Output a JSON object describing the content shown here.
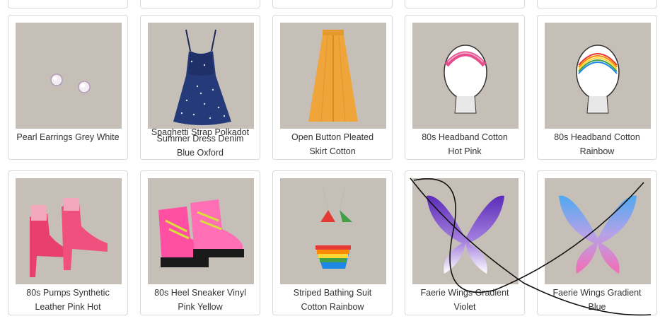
{
  "grid": {
    "row1": [
      {
        "label_line1": "Pearl Earrings Grey White",
        "label_line2": "",
        "icon": "pearl-earrings-icon"
      },
      {
        "label_line1": "Summer Dress Denim",
        "label_line2": "Blue Oxford",
        "overlay": "Spaghetti Strap Polkadot",
        "icon": "polkadot-dress-icon"
      },
      {
        "label_line1": "Open Button Pleated",
        "label_line2": "Skirt Cotton",
        "icon": "pleated-skirt-icon"
      },
      {
        "label_line1": "80s Headband Cotton",
        "label_line2": "Hot Pink",
        "icon": "headband-pink-icon"
      },
      {
        "label_line1": "80s Headband Cotton",
        "label_line2": "Rainbow",
        "icon": "headband-rainbow-icon"
      }
    ],
    "row2": [
      {
        "label_line1": "80s Pumps Synthetic",
        "label_line2": "Leather Pink Hot",
        "icon": "pink-pumps-icon"
      },
      {
        "label_line1": "80s Heel Sneaker Vinyl",
        "label_line2": "Pink Yellow",
        "icon": "heel-sneaker-icon"
      },
      {
        "label_line1": "Striped Bathing Suit",
        "label_line2": "Cotton Rainbow",
        "icon": "bathing-suit-icon"
      },
      {
        "label_line1": "Faerie Wings Gradient",
        "label_line2": "Violet",
        "icon": "violet-wings-icon"
      },
      {
        "label_line1": "Faerie Wings Gradient",
        "label_line2": "Blue",
        "icon": "blue-wings-icon"
      }
    ]
  },
  "colors": {
    "thumb_bg": "#c5bfb8",
    "card_border": "#d9d9d9"
  }
}
